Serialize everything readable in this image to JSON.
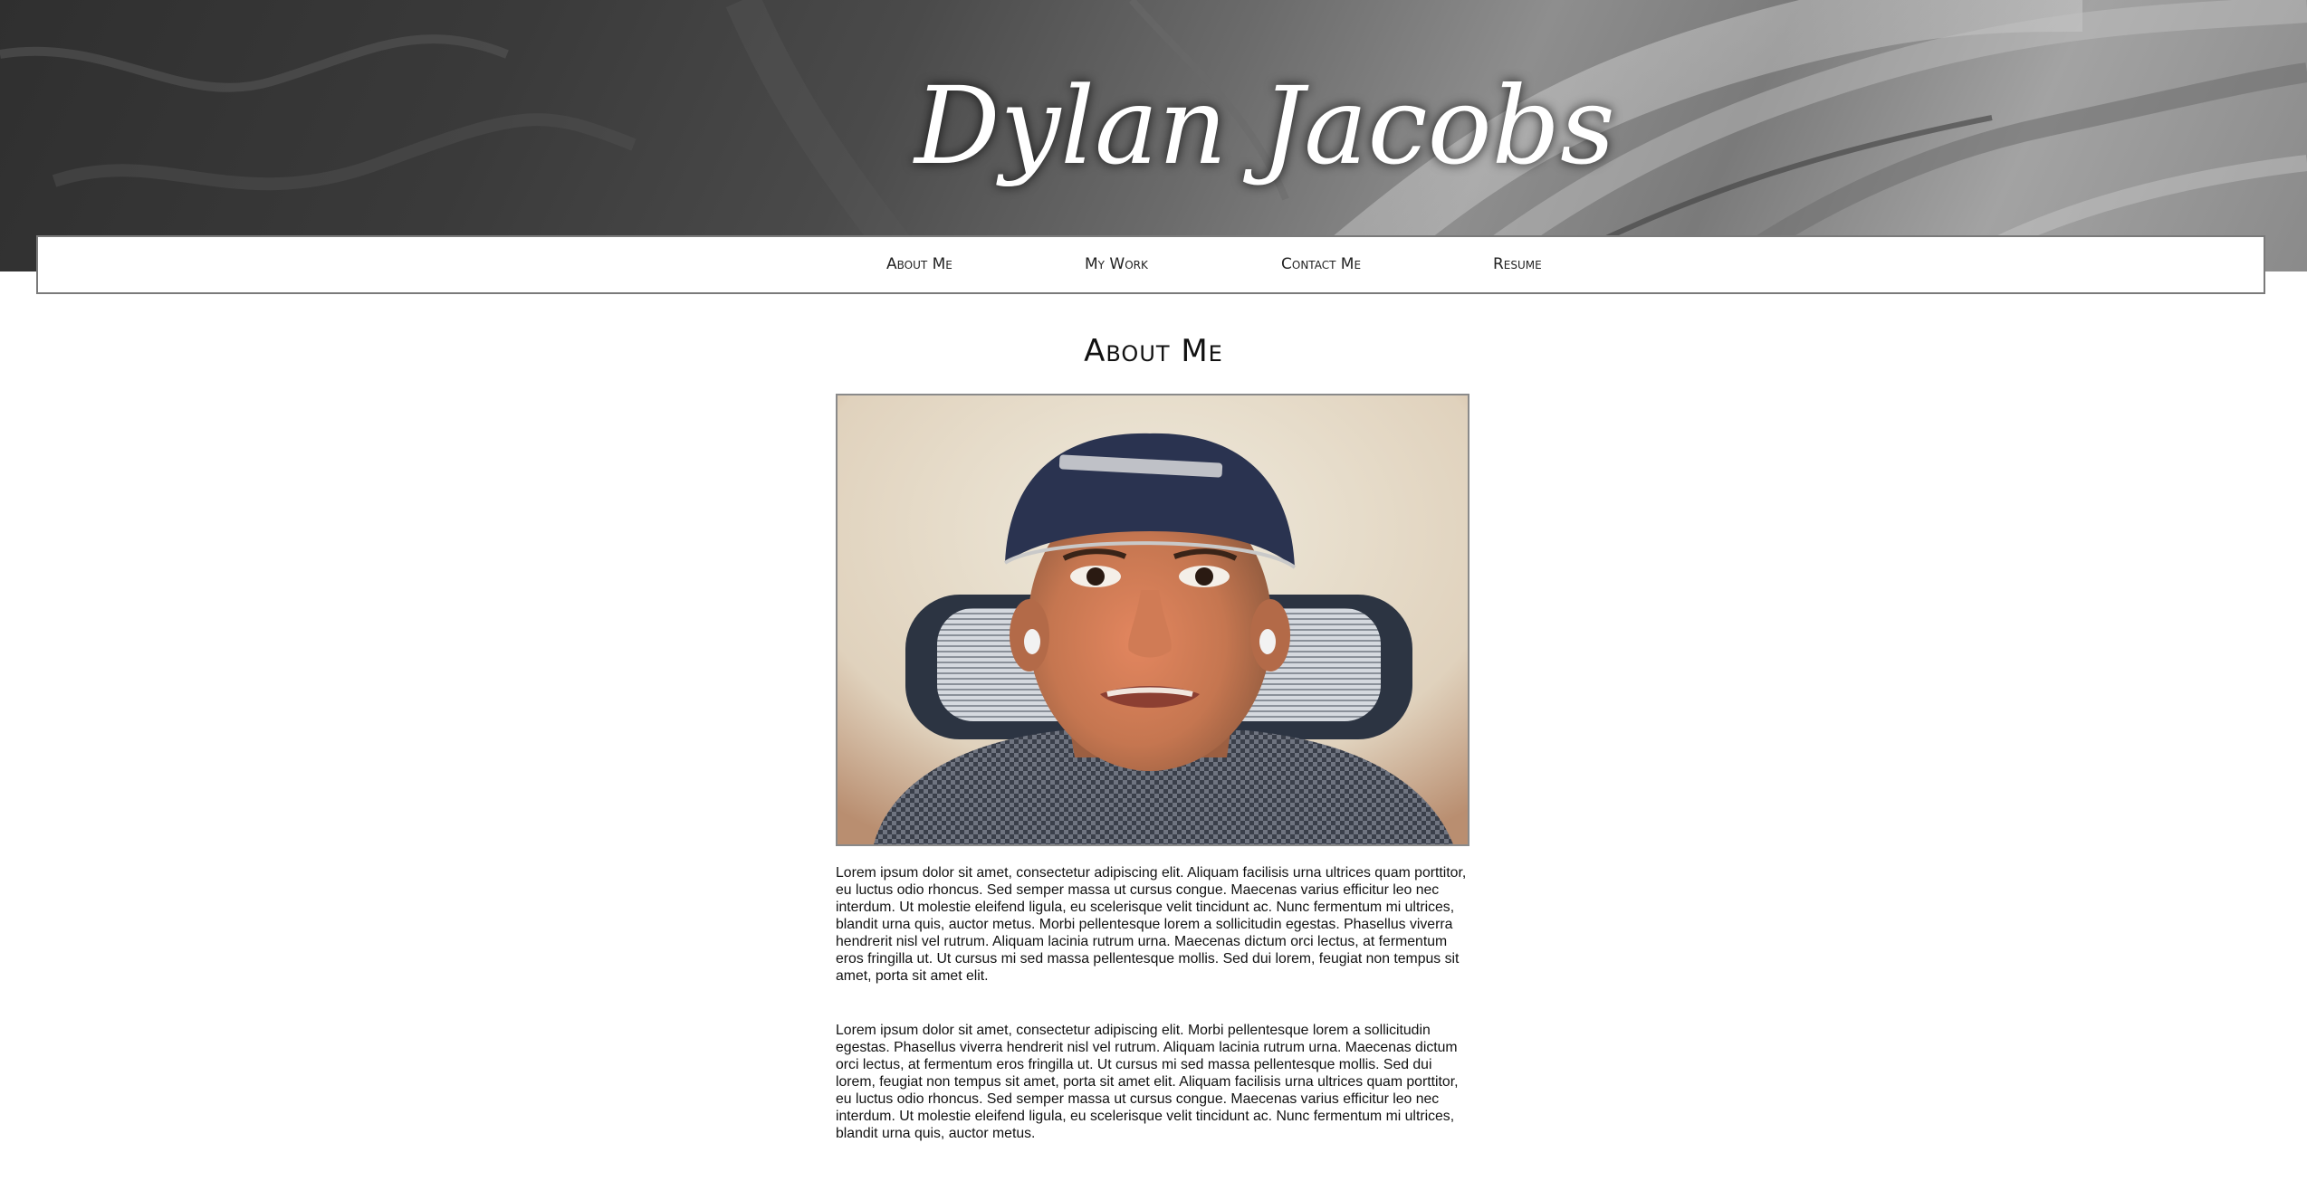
{
  "header": {
    "logo_text": "Dylan Jacobs"
  },
  "nav": {
    "items": [
      {
        "label": "About Me"
      },
      {
        "label": "My Work"
      },
      {
        "label": "Contact Me"
      },
      {
        "label": "Resume"
      }
    ]
  },
  "main": {
    "title": "About Me",
    "paragraphs": [
      "Lorem ipsum dolor sit amet, consectetur adipiscing elit. Aliquam facilisis urna ultrices quam porttitor, eu luctus odio rhoncus. Sed semper massa ut cursus congue. Maecenas varius efficitur leo nec interdum. Ut molestie eleifend ligula, eu scelerisque velit tincidunt ac. Nunc fermentum mi ultrices, blandit urna quis, auctor metus. Morbi pellentesque lorem a sollicitudin egestas. Phasellus viverra hendrerit nisl vel rutrum. Aliquam lacinia rutrum urna. Maecenas dictum orci lectus, at fermentum eros fringilla ut. Ut cursus mi sed massa pellentesque mollis. Sed dui lorem, feugiat non tempus sit amet, porta sit amet elit.",
      "Lorem ipsum dolor sit amet, consectetur adipiscing elit. Morbi pellentesque lorem a sollicitudin egestas. Phasellus viverra hendrerit nisl vel rutrum. Aliquam lacinia rutrum urna. Maecenas dictum orci lectus, at fermentum eros fringilla ut. Ut cursus mi sed massa pellentesque mollis. Sed dui lorem, feugiat non tempus sit amet, porta sit amet elit. Aliquam facilisis urna ultrices quam porttitor, eu luctus odio rhoncus. Sed semper massa ut cursus congue. Maecenas varius efficitur leo nec interdum. Ut molestie eleifend ligula, eu scelerisque velit tincidunt ac. Nunc fermentum mi ultrices, blandit urna quis, auctor metus."
    ]
  },
  "colors": {
    "header_dark": "#2f2f2f",
    "header_light": "#a3a3a3",
    "nav_border": "#7a7a7a",
    "text": "#111111"
  }
}
